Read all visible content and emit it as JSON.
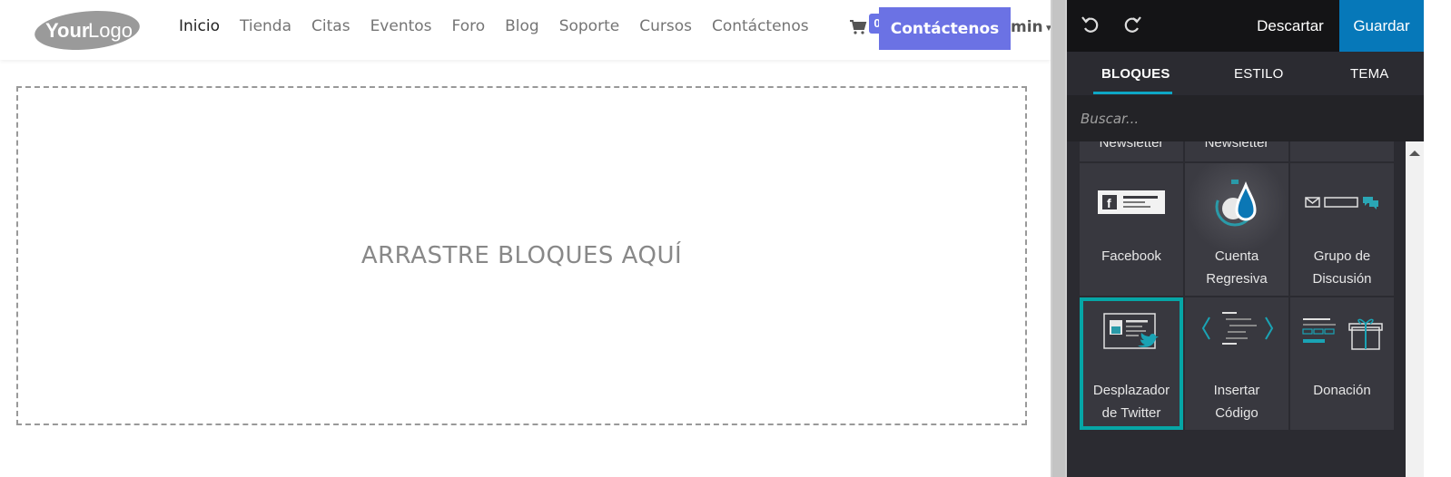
{
  "header": {
    "logo_alt": "Your Logo",
    "nav": [
      {
        "label": "Inicio",
        "active": true
      },
      {
        "label": "Tienda",
        "active": false
      },
      {
        "label": "Citas",
        "active": false
      },
      {
        "label": "Eventos",
        "active": false
      },
      {
        "label": "Foro",
        "active": false
      },
      {
        "label": "Blog",
        "active": false
      },
      {
        "label": "Soporte",
        "active": false
      },
      {
        "label": "Cursos",
        "active": false
      },
      {
        "label": "Contáctenos",
        "active": false
      }
    ],
    "cart_icon": "cart-icon",
    "cart_count": "0",
    "cta_label": "Contáctenos",
    "user_fragment": "min"
  },
  "main": {
    "dropzone_text": "ARRASTRE BLOQUES AQUÍ"
  },
  "editor": {
    "undo_icon": "undo-icon",
    "redo_icon": "redo-icon",
    "discard_label": "Descartar",
    "save_label": "Guardar",
    "tabs": [
      {
        "label": "BLOQUES",
        "active": true
      },
      {
        "label": "ESTILO",
        "active": false
      },
      {
        "label": "TEMA",
        "active": false
      }
    ],
    "search_placeholder": "Buscar...",
    "blocks_partial_row": [
      "Newsletter",
      "Newsletter",
      ""
    ],
    "blocks": [
      {
        "label_line1": "Facebook",
        "label_line2": "",
        "icon": "facebook-block-icon",
        "selected": false
      },
      {
        "label_line1": "Cuenta",
        "label_line2": "Regresiva",
        "icon": "countdown-icon",
        "selected": false
      },
      {
        "label_line1": "Grupo de",
        "label_line2": "Discusión",
        "icon": "discussion-group-icon",
        "selected": false
      },
      {
        "label_line1": "Desplazador",
        "label_line2": "de Twitter",
        "icon": "twitter-scroller-icon",
        "selected": true
      },
      {
        "label_line1": "Insertar",
        "label_line2": "Código",
        "icon": "embed-code-icon",
        "selected": false
      },
      {
        "label_line1": "Donación",
        "label_line2": "",
        "icon": "donation-icon",
        "selected": false
      }
    ]
  },
  "colors": {
    "accent": "#6b72e4",
    "editor_bg": "#2b2b31",
    "save_bg": "#0678b9",
    "tab_underline": "#0ea7c5",
    "selected_outline": "#06a6a6"
  }
}
